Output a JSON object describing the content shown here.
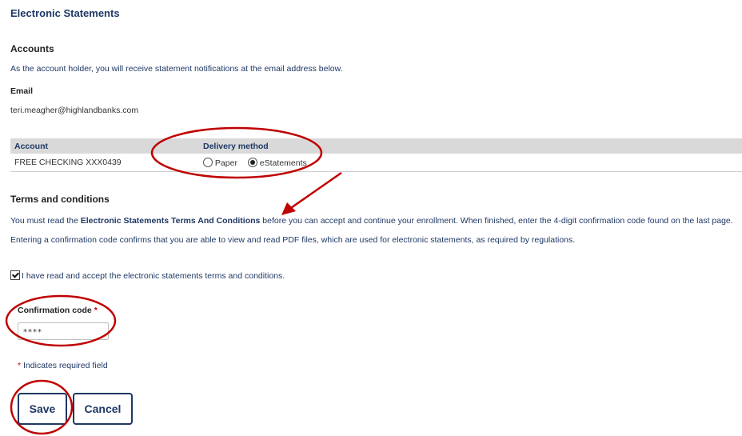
{
  "page": {
    "title": "Electronic Statements"
  },
  "accounts": {
    "heading": "Accounts",
    "notice": "As the account holder, you will receive statement notifications at the email address below.",
    "email_label": "Email",
    "email_value": "teri.meagher@highlandbanks.com",
    "table": {
      "headers": [
        "Account",
        "Delivery method"
      ],
      "rows": [
        {
          "account": "FREE CHECKING XXX0439",
          "options": [
            "Paper",
            "eStatements"
          ],
          "selected": "eStatements"
        }
      ]
    }
  },
  "terms": {
    "heading": "Terms and conditions",
    "text_before": "You must read the ",
    "link": "Electronic Statements Terms And Conditions",
    "text_after": " before you can accept and continue your enrollment. When finished, enter the 4-digit confirmation code found on the last page. Entering a confirmation code confirms that you are able to view and read PDF files, which are used for electronic statements, as required by regulations.",
    "accept_label": "I have read and accept the electronic statements terms and conditions.",
    "accepted": true
  },
  "confirmation": {
    "label": "Confirmation code",
    "required_mark": "*",
    "value": "****"
  },
  "required_note": {
    "mark": "*",
    "text": " Indicates required field"
  },
  "buttons": {
    "save": "Save",
    "cancel": "Cancel"
  },
  "colors": {
    "brand": "#1f3864",
    "annotation": "#c00000",
    "table_header": "#d9d9d9"
  }
}
